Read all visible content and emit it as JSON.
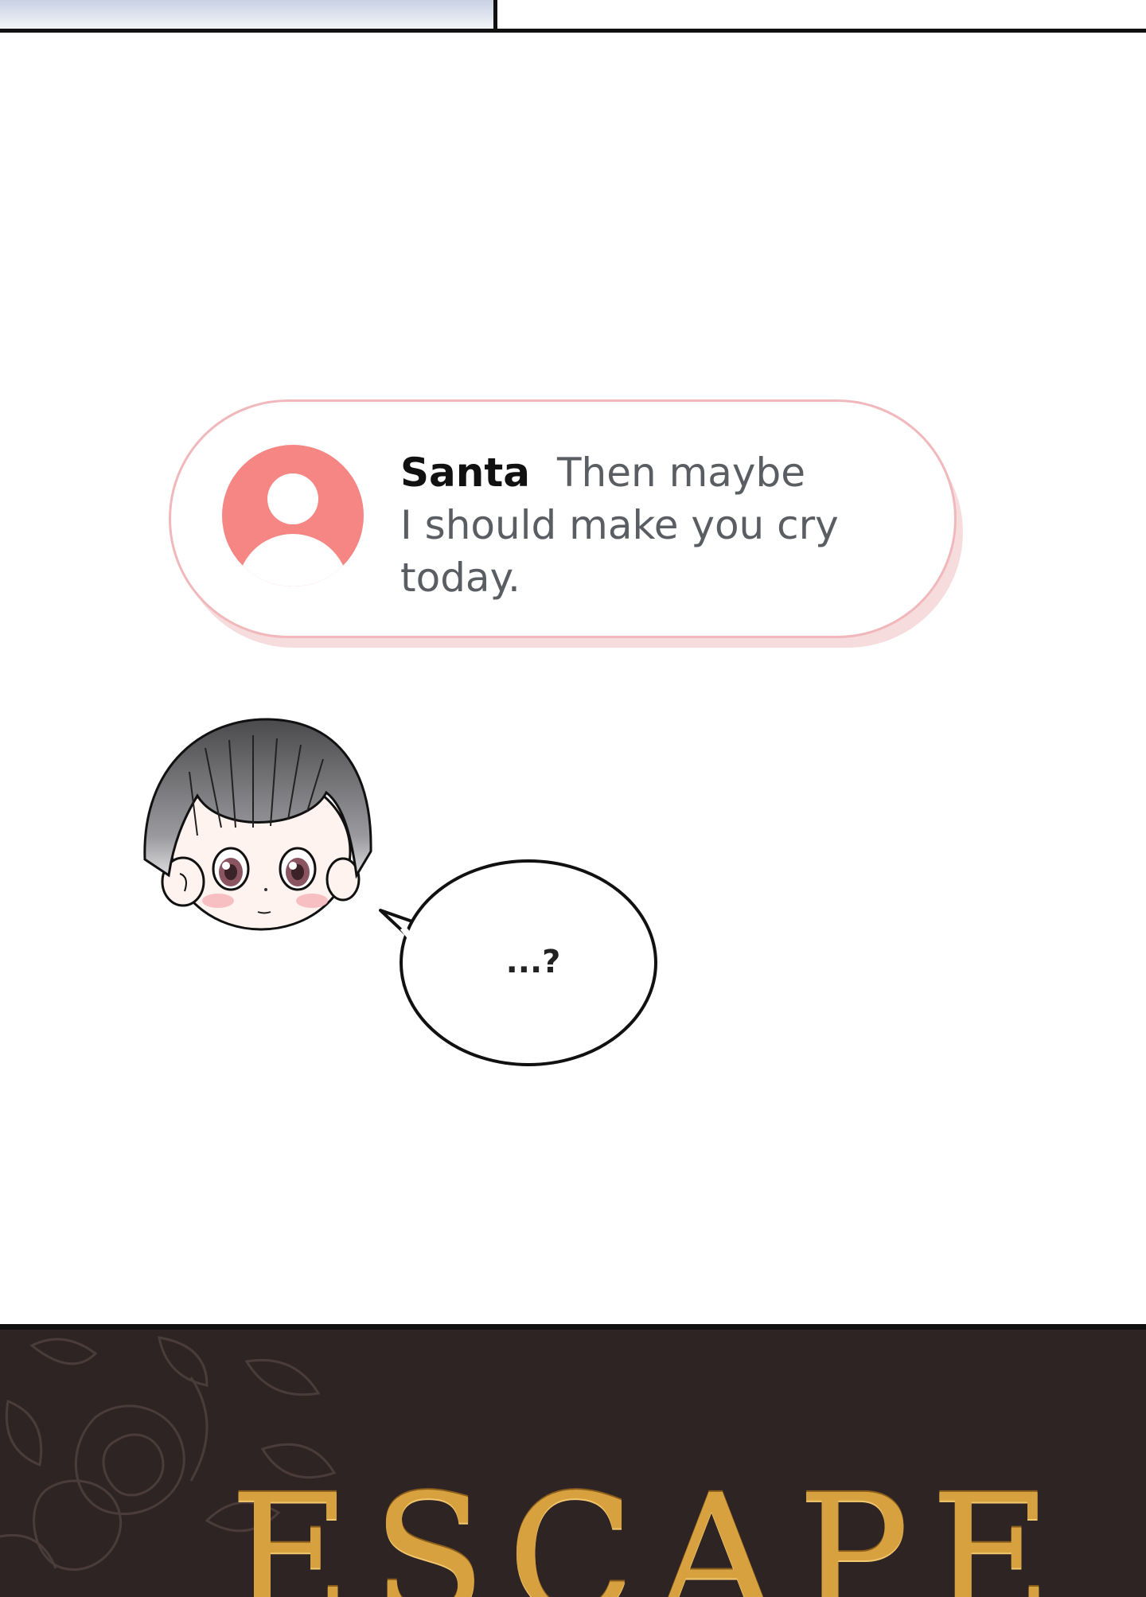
{
  "notification": {
    "sender": "Santa",
    "message_line1": "Then maybe",
    "message_line2": "I should make you cry",
    "message_line3": "today.",
    "avatar_icon": "user-avatar-icon",
    "accent_color": "#f68684"
  },
  "speech_bubble": {
    "text": "...?"
  },
  "footer": {
    "title": "ESCAPE",
    "title_color": "#d7a140",
    "background_color": "#2f2424"
  }
}
